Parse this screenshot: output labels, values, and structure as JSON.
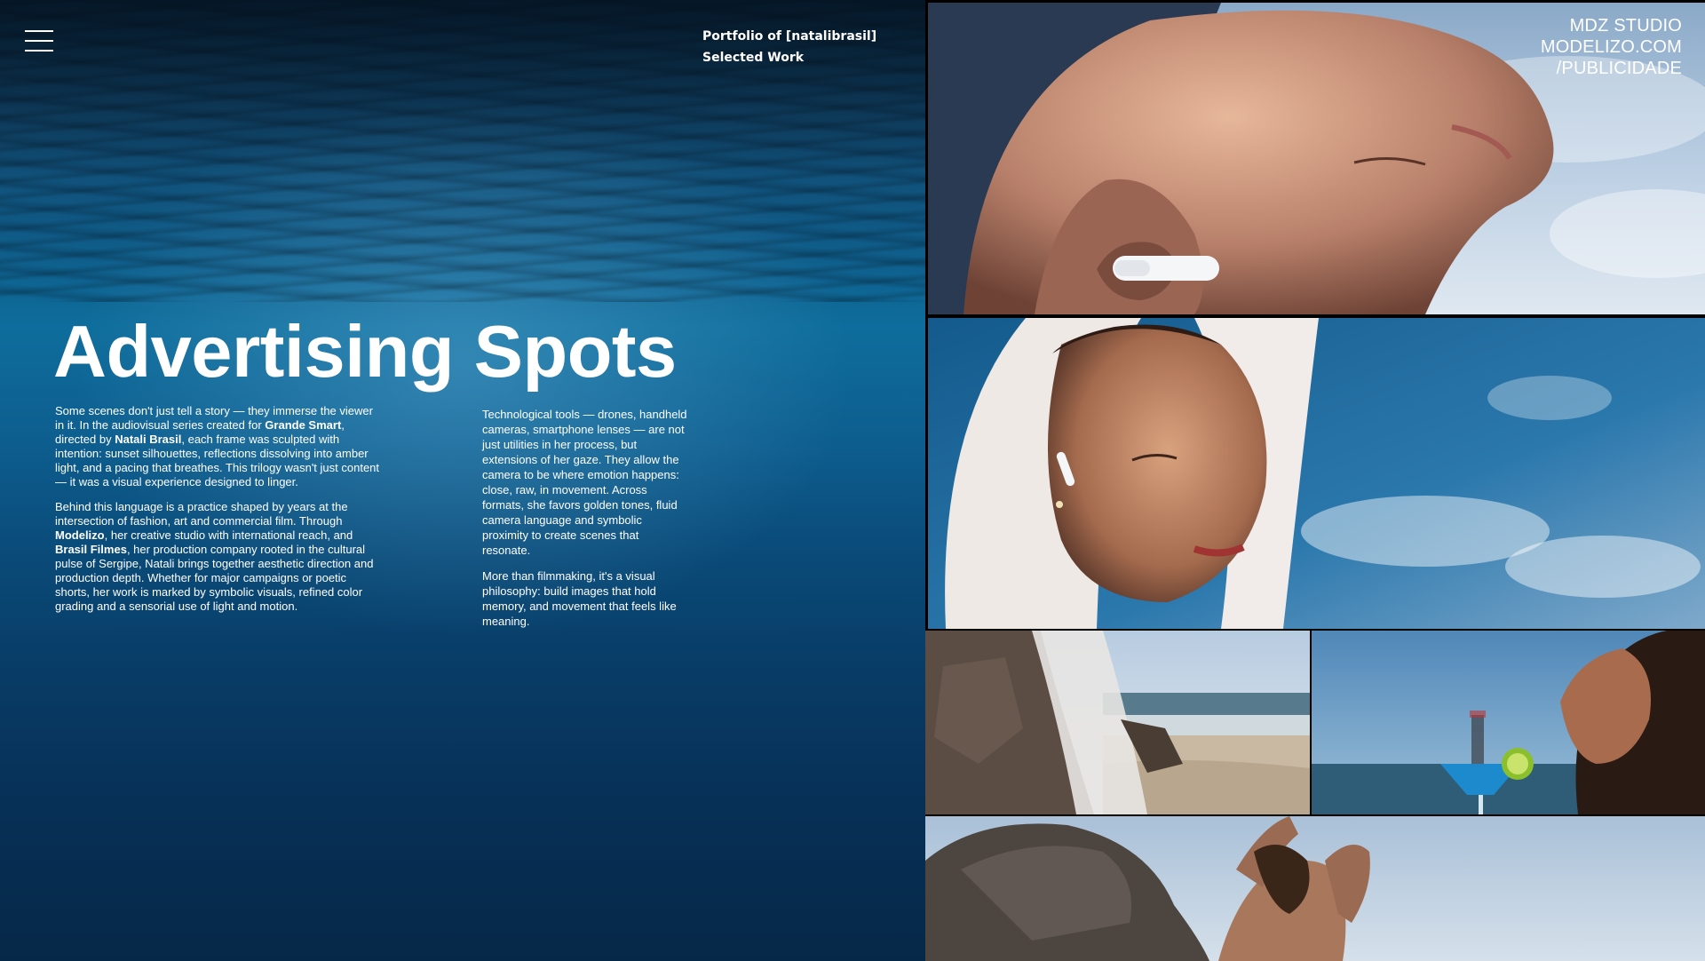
{
  "header": {
    "portfolio_label": "Portfolio of [natalibrasil]",
    "section_label": "Selected Work"
  },
  "studio_credit": {
    "line1": "MDZ STUDIO",
    "line2": "MODELIZO.COM",
    "line3": "/PUBLICIDADE"
  },
  "hero": {
    "title": "Advertising Spots"
  },
  "intro_column": {
    "p1_a": "Some scenes don't just tell a story — they immerse the viewer in it. In the audiovisual series created for ",
    "p1_b": "Grande Smart",
    "p1_c": ", directed by ",
    "p1_d": "Natali Brasil",
    "p1_e": ", each frame was sculpted with intention: sunset silhouettes, reflections dissolving into amber light, and a pacing that breathes. This trilogy wasn't just content — it was a visual experience designed to linger.",
    "p2_a": "Behind this language is a practice shaped by years at the intersection of fashion, art and commercial film. Through ",
    "p2_b": "Modelizo",
    "p2_c": ", her creative studio with international reach, and ",
    "p2_d": "Brasil Filmes",
    "p2_e": ", her production company rooted in the cultural pulse of Sergipe, Natali brings together aesthetic direction and production depth. Whether for major campaigns or poetic shorts, her work is marked by symbolic visuals, refined color grading and a sensorial use of light and motion."
  },
  "second_column": {
    "p1": "Technological tools — drones, handheld cameras, smartphone lenses — are not just utilities in her process, but extensions of her gaze. They allow the camera to be where emotion happens: close, raw, in movement. Across formats, she favors golden tones, fluid camera language and symbolic proximity to create scenes that resonate.",
    "p2": "More than filmmaking, it's a visual philosophy: build images that hold memory, and movement that feels like meaning."
  },
  "colors": {
    "ocean_top": "#0d2f4a",
    "ocean_mid": "#0e6d9c",
    "ocean_bottom": "#062848",
    "text": "#ffffff",
    "gallery_gap": "#000000"
  },
  "icons": {
    "menu": "hamburger-menu-icon"
  }
}
